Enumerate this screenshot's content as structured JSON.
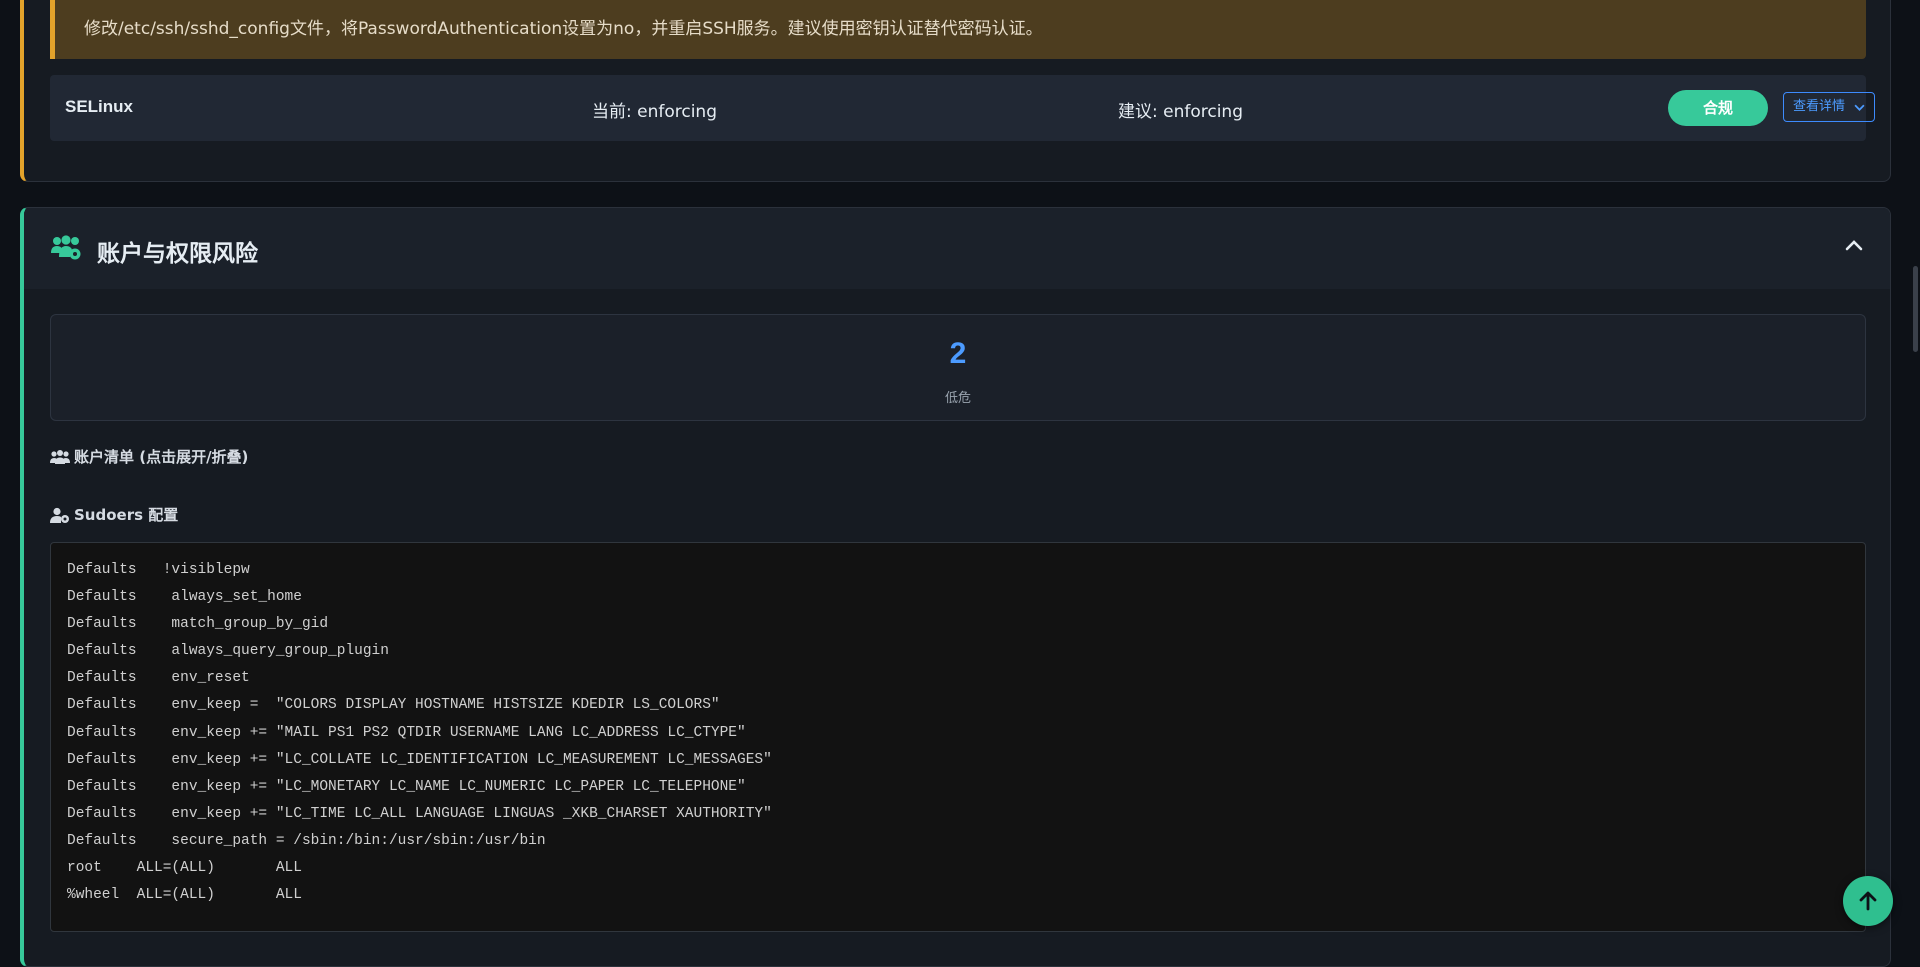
{
  "warning": {
    "text": "修改/etc/ssh/sshd_config文件，将PasswordAuthentication设置为no，并重启SSH服务。建议使用密钥认证替代密码认证。"
  },
  "check_row": {
    "name": "SELinux",
    "current": "当前: enforcing",
    "recommended": "建议: enforcing",
    "status": "合规",
    "detail_label": "查看详情"
  },
  "account_section": {
    "title": "账户与权限风险",
    "stat_value": "2",
    "stat_label": "低危",
    "accounts_label": "账户清单 (点击展开/折叠)",
    "sudoers_label": "Sudoers 配置",
    "sudoers_lines": [
      "Defaults   !visiblepw",
      "Defaults    always_set_home",
      "Defaults    match_group_by_gid",
      "Defaults    always_query_group_plugin",
      "Defaults    env_reset",
      "Defaults    env_keep =  \"COLORS DISPLAY HOSTNAME HISTSIZE KDEDIR LS_COLORS\"",
      "Defaults    env_keep += \"MAIL PS1 PS2 QTDIR USERNAME LANG LC_ADDRESS LC_CTYPE\"",
      "Defaults    env_keep += \"LC_COLLATE LC_IDENTIFICATION LC_MEASUREMENT LC_MESSAGES\"",
      "Defaults    env_keep += \"LC_MONETARY LC_NAME LC_NUMERIC LC_PAPER LC_TELEPHONE\"",
      "Defaults    env_keep += \"LC_TIME LC_ALL LANGUAGE LINGUAS _XKB_CHARSET XAUTHORITY\"",
      "Defaults    secure_path = /sbin:/bin:/usr/sbin:/usr/bin",
      "root    ALL=(ALL)       ALL",
      "%wheel  ALL=(ALL)       ALL"
    ]
  },
  "icons": {
    "users": "users-cog-icon",
    "collapse": "chevron-up-icon",
    "scroll_top": "arrow-up-icon"
  },
  "colors": {
    "accent_green": "#37c99a",
    "accent_yellow": "#e3a32b",
    "accent_blue": "#4c9bff"
  }
}
